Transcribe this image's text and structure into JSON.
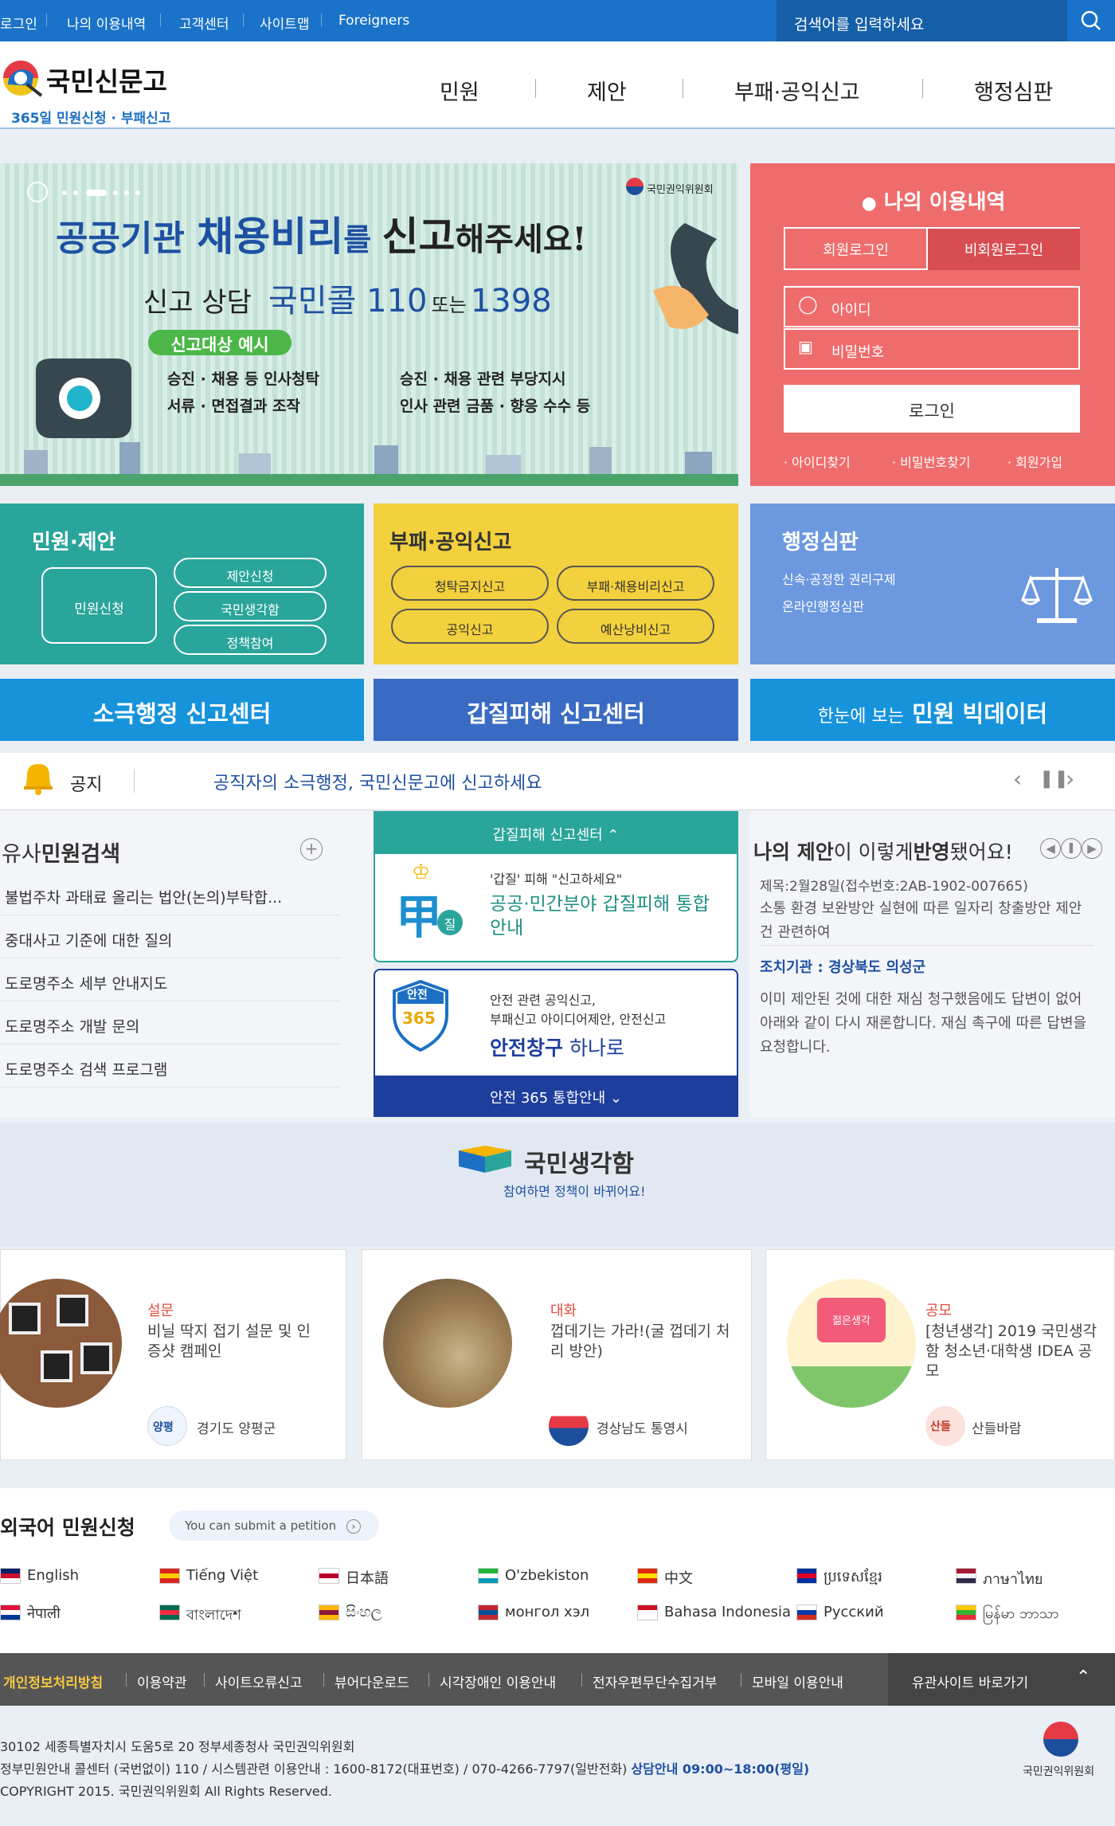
{
  "topbar": {
    "links": [
      "로그인",
      "나의 이용내역",
      "고객센터",
      "사이트맵",
      "Foreigners"
    ],
    "search_placeholder": "검색어를 입력하세요"
  },
  "logo": {
    "title": "국민신문고",
    "subtitle": "365일 민원신청 · 부패신고"
  },
  "gnb": [
    "민원",
    "제안",
    "부패·공익신고",
    "행정심판"
  ],
  "banner": {
    "agency": "국민권익위원회",
    "headline_a": "공공기관 ",
    "headline_b": "채용비리",
    "headline_c": "를 ",
    "headline_d": "신고",
    "headline_e": "해주세요!",
    "call_prefix": "신고 상담",
    "call_name": "국민콜 110",
    "call_or": "또는",
    "call_num": "1398",
    "examples_title": "신고대상 예시",
    "examples": [
      "승진 · 채용 등 인사청탁",
      "승진 · 채용 관련 부당지시",
      "서류 · 면접결과 조작",
      "인사 관련 금품 · 향응 수수 등"
    ]
  },
  "login": {
    "title": "나의 이용내역",
    "tab_member": "회원로그인",
    "tab_guest": "비회원로그인",
    "id_placeholder": "아이디",
    "pw_placeholder": "비밀번호",
    "login_button": "로그인",
    "links": [
      "· 아이디찾기",
      "· 비밀번호찾기",
      "· 회원가입"
    ]
  },
  "services": {
    "minwon": {
      "title": "민원·제안",
      "main": "민원신청",
      "items": [
        "제안신청",
        "국민생각함",
        "정책참여"
      ]
    },
    "report": {
      "title": "부패·공익신고",
      "items": [
        "청탁금지신고",
        "부패·채용비리신고",
        "공익신고",
        "예산낭비신고"
      ]
    },
    "trial": {
      "title": "행정심판",
      "lines": [
        "신속·공정한 권리구제",
        "온라인행정심판"
      ]
    }
  },
  "big_buttons": {
    "passive": "소극행정 신고센터",
    "gapjil": "갑질피해 신고센터",
    "bigdata_prefix": "한눈에 보는",
    "bigdata": "민원 빅데이터"
  },
  "notice": {
    "label": "공지",
    "text": "공직자의 소극행정, 국민신문고에 신고하세요"
  },
  "similar": {
    "title_a": "유사",
    "title_b": "민원검색",
    "items": [
      "불법주차 과태료 올리는 법안(논의)부탁합...",
      "중대사고 기준에 대한 질의",
      "도로명주소 세부 안내지도",
      "도로명주소 개발 문의",
      "도로명주소 검색 프로그램"
    ]
  },
  "gapjil": {
    "header": "갑질피해 신고센터",
    "small": "'갑질' 피해 \"신고하세요\"",
    "big": "공공·민간분야 갑질피해 통합안내",
    "badge_a": "甲",
    "badge_b": "질"
  },
  "safety": {
    "line1": "안전 관련 공익신고,",
    "line2": "부패신고 아이디어제안, 안전신고",
    "big_a": "안전창구",
    "big_b": " 하나로",
    "shield_top": "안전",
    "shield_num": "365",
    "footer": "안전 365 통합안내"
  },
  "myproposal": {
    "title_a": "나의 제안",
    "title_b": "이 이렇게",
    "title_c": "반영",
    "title_d": "됐어요!",
    "meta": "제목:2월28일(접수번호:2AB-1902-007665)",
    "subject": "소통 환경 보완방안 실현에 따른 일자리 창출방안 제안 건 관련하여",
    "org": "조치기관 : 경상북도 의성군",
    "body": "이미 제안된 것에 대한 재심 청구했음에도 답변이 없어 아래와 같이 다시 재론합니다. 재심 촉구에 따른 답변을 요청합니다."
  },
  "ideas": {
    "title": "국민생각함",
    "sub": "참여하면 정책이 바뀌어요!",
    "cards": [
      {
        "type": "설문",
        "title": "비닐 딱지 접기 설문 및 인증샷 캠페인",
        "org": "경기도 양평군",
        "org_mark": "양평"
      },
      {
        "type": "대화",
        "title": "껍데기는 가라!(굴 껍데기 처리 방안)",
        "org": "경상남도 통영시"
      },
      {
        "type": "공모",
        "title": "[청년생각] 2019 국민생각함 청소년·대학생 IDEA 공모",
        "org": "산들바람",
        "org_mark": "산들",
        "poster": "젊은생각"
      }
    ]
  },
  "foreign": {
    "title": "외국어 민원신청",
    "pill": "You can submit a petition",
    "langs_row1": [
      "English",
      "Tiếng Việt",
      "日本語",
      "O'zbekiston",
      "中文",
      "ប្រទេសខ្មែរ",
      "ภาษาไทย"
    ],
    "langs_row2": [
      "नेपाली",
      "বাংলাদেশ",
      "සිංහල",
      "монгол хэл",
      "Bahasa Indonesia",
      "Русский",
      "မြန်မာ ဘာသာ"
    ]
  },
  "footer": {
    "links": [
      "개인정보처리방침",
      "이용약관",
      "사이트오류신고",
      "뷰어다운로드",
      "시각장애인 이용안내",
      "전자우편무단수집거부",
      "모바일 이용안내"
    ],
    "related": "유관사이트 바로가기",
    "address": "30102 세종특별자치시 도움5로 20 정부세종청사 국민권익위원회",
    "call": "정부민원안내 콜센터 (국번없이) 110 / 시스템관련 이용안내 : 1600-8172(대표번호) / 070-4266-7797(일반전화)",
    "hours": "상담안내 09:00~18:00(평일)",
    "copyright": "COPYRIGHT 2015. 국민권익위원회 All Rights Reserved.",
    "agency": "국민권익위원회"
  },
  "colors": {
    "blue": "#1a73c8",
    "teal": "#2aa59b",
    "yellow": "#f3d03d",
    "lavender": "#6c98e0",
    "salmon": "#ef6c6c",
    "navy": "#3a6bc4"
  }
}
